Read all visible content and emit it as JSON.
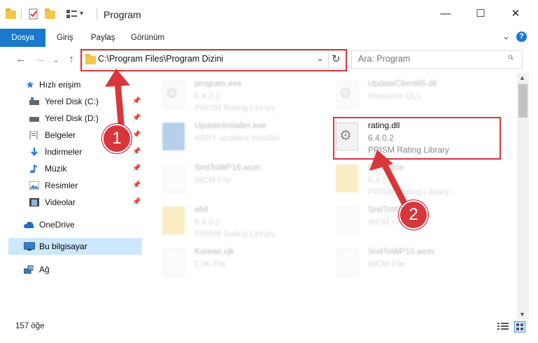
{
  "window": {
    "title": "Program",
    "minimize": "—",
    "maximize": "☐",
    "close": "✕"
  },
  "ribbon": {
    "tabs": [
      "Dosya",
      "Giriş",
      "Paylaş",
      "Görünüm"
    ],
    "collapse": "⌄",
    "help": "?"
  },
  "nav": {
    "back": "←",
    "forward": "→",
    "recent": "⌄",
    "up": "↑",
    "address": "C:\\Program Files\\Program Dizini",
    "dropdown": "⌄",
    "refresh": "↻",
    "search_placeholder": "Ara: Program",
    "search_icon": "⌕"
  },
  "sidebar": {
    "quick_access": "Hızlı erişim",
    "items": [
      {
        "label": "Yerel Disk (C:)",
        "icon": "drive-icon"
      },
      {
        "label": "Yerel Disk (D:)",
        "icon": "drive-icon"
      },
      {
        "label": "Belgeler",
        "icon": "documents-icon"
      },
      {
        "label": "İndirmeler",
        "icon": "download-icon"
      },
      {
        "label": "Müzik",
        "icon": "music-icon"
      },
      {
        "label": "Resimler",
        "icon": "pictures-icon"
      },
      {
        "label": "Videolar",
        "icon": "videos-icon"
      }
    ],
    "onedrive": "OneDrive",
    "this_pc": "Bu bilgisayar",
    "network": "Ağ",
    "pin": "📌"
  },
  "files": {
    "left": [
      {
        "name": "program.exe",
        "version": "6.4.0.2",
        "desc": "PRISM Rating Library"
      },
      {
        "name": "UpdateInstaller.exe",
        "version": "ABBY updates installer",
        "desc": ""
      },
      {
        "name": "SndToWP16.wcm",
        "version": "WCM File",
        "desc": ""
      },
      {
        "name": "x64",
        "version": "6.4.0.2",
        "desc": "PRISM Rating Library"
      },
      {
        "name": "Korean.cjk",
        "version": "CJK File",
        "desc": ""
      }
    ],
    "right": [
      {
        "name": "UpdateClient65.dll",
        "version": "Resource DLL",
        "desc": ""
      },
      {
        "name": "rating.dll",
        "version": "6.4.0.2",
        "desc": "PRISM Rating Library"
      },
      {
        "name": "Resource",
        "version": "6.4.0.2",
        "desc": "PRISM Rating Library"
      },
      {
        "name": "SndToWP.wcm",
        "version": "WCM File",
        "desc": ""
      },
      {
        "name": "SndToWP15.wcm",
        "version": "WCM File",
        "desc": ""
      }
    ]
  },
  "status": {
    "count": "157 öğe"
  },
  "annotations": {
    "step1": "1",
    "step2": "2",
    "color": "#d9363b"
  },
  "colors": {
    "accent": "#1979ca",
    "selected": "#cce8ff"
  }
}
